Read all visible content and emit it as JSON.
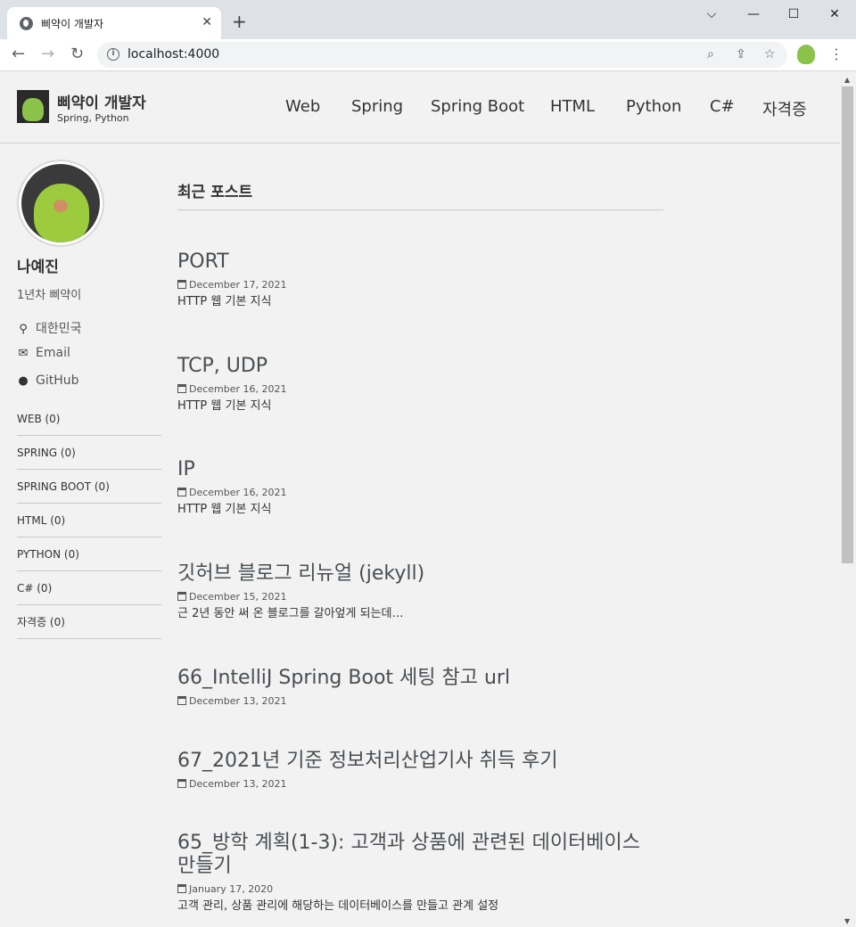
{
  "browser": {
    "tab_title": "삐약이 개발자",
    "tab_close": "✕",
    "new_tab": "+",
    "url": "localhost:4000",
    "window_controls": {
      "minimize": "⌵",
      "restore": "—",
      "maximize": "☐",
      "close": "✕"
    }
  },
  "site": {
    "title": "삐약이 개발자",
    "subtitle": "Spring, Python",
    "nav": [
      "Web",
      "Spring",
      "Spring Boot",
      "HTML",
      "Python",
      "C#",
      "자격증"
    ]
  },
  "author": {
    "name": "나예진",
    "bio": "1년차 삐약이",
    "links": [
      {
        "icon": "map-marker-icon",
        "label": "대한민국"
      },
      {
        "icon": "envelope-icon",
        "label": "Email"
      },
      {
        "icon": "github-icon",
        "label": "GitHub"
      }
    ]
  },
  "categories": [
    "WEB (0)",
    "SPRING (0)",
    "SPRING BOOT (0)",
    "HTML (0)",
    "PYTHON (0)",
    "C# (0)",
    "자격증 (0)"
  ],
  "recent": {
    "title": "최근 포스트",
    "posts": [
      {
        "title": "PORT",
        "date": "December 17, 2021",
        "excerpt": "HTTP 웹 기본 지식"
      },
      {
        "title": "TCP, UDP",
        "date": "December 16, 2021",
        "excerpt": "HTTP 웹 기본 지식"
      },
      {
        "title": "IP",
        "date": "December 16, 2021",
        "excerpt": "HTTP 웹 기본 지식"
      },
      {
        "title": "깃허브 블로그 리뉴얼 (jekyll)",
        "date": "December 15, 2021",
        "excerpt": "근 2년 동안 써 온 블로그를 갈아엎게 되는데…"
      },
      {
        "title": "66_IntelliJ Spring Boot 세팅 참고 url",
        "date": "December 13, 2021",
        "excerpt": ""
      },
      {
        "title": "67_2021년 기준 정보처리산업기사 취득 후기",
        "date": "December 13, 2021",
        "excerpt": ""
      },
      {
        "title": "65_방학 계획(1-3): 고객과 상품에 관련된 데이터베이스 만들기",
        "date": "January 17, 2020",
        "excerpt": "고객 관리, 상품 관리에 해당하는 데이터베이스를 만들고 관계 설정"
      }
    ]
  }
}
